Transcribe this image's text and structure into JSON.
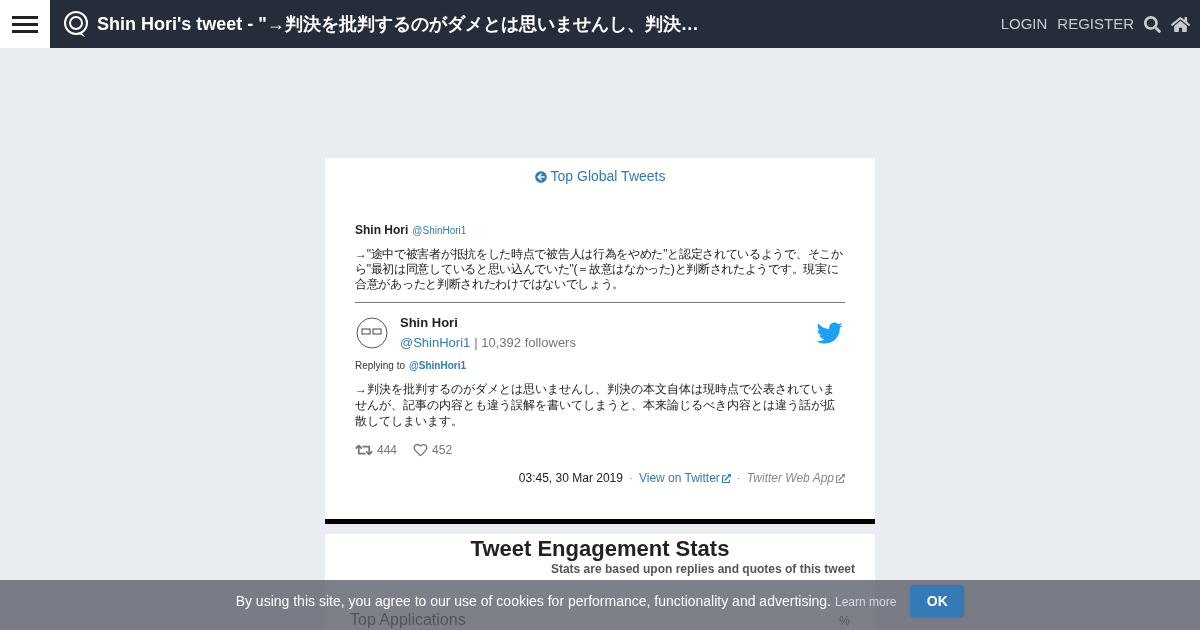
{
  "header": {
    "title": "Shin Hori's tweet - \"→判決を批判するのがダメとは思いませんし、判決…",
    "links": [
      "LOGIN",
      "REGISTER"
    ]
  },
  "back_link": "Top Global Tweets",
  "parent_tweet": {
    "name": "Shin Hori",
    "handle": "@ShinHori1",
    "text": "→\"途中で被害者が抵抗をした時点で被告人は行為をやめた\"と認定されているようで、そこから\"最初は同意していると思い込んでいた\"(＝故意はなかった)と判断されたようです。現実に合意があったと判断されたわけではないでしょう。"
  },
  "tweet": {
    "name": "Shin Hori",
    "handle": "@ShinHori1",
    "followers": "| 10,392 followers",
    "replying_label": "Replying to",
    "replying_handle": "@ShinHori1",
    "text": "→判決を批判するのがダメとは思いませんし、判決の本文自体は現時点で公表されていませんが、記事の内容とも違う誤解を書いてしまうと、本来論じるべき内容とは違う話が拡散してしまいます。",
    "retweets": "444",
    "likes": "452",
    "time": "03:45, 30 Mar 2019",
    "separator": "·",
    "view_link": "View on Twitter",
    "source": "Twitter Web App"
  },
  "stats": {
    "title": "Tweet Engagement Stats",
    "note": "Stats are based upon replies and quotes of this tweet",
    "section": "Top Applications",
    "column": "%"
  },
  "cookie_bar": {
    "text": "By using this site, you agree to our use of cookies for performance, functionality and advertising.",
    "link": "Learn more",
    "button": "OK"
  }
}
